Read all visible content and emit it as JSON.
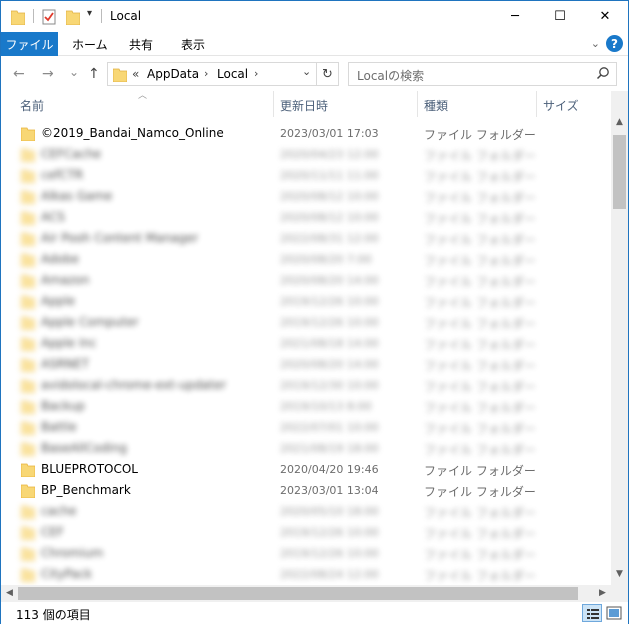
{
  "window": {
    "title": "Local",
    "controls": {
      "minimize": "─",
      "maximize": "☐",
      "close": "✕"
    }
  },
  "ribbon": {
    "tabs": [
      "ファイル",
      "ホーム",
      "共有",
      "表示"
    ],
    "help_label": "?"
  },
  "nav": {
    "back": "←",
    "forward": "→",
    "recent": "⌄",
    "up": "↑",
    "breadcrumb_overflow": "«",
    "breadcrumb": [
      "AppData",
      "Local"
    ],
    "refresh": "↻",
    "search_placeholder": "Localの検索"
  },
  "columns": [
    "名前",
    "更新日時",
    "種類",
    "サイズ"
  ],
  "files": [
    {
      "name": "©2019_Bandai_Namco_Online",
      "date": "2023/03/01 17:03",
      "type": "ファイル フォルダー",
      "blurred": false
    },
    {
      "name": "CEFCache",
      "date": "2020/04/23 12:00",
      "type": "ファイル フォルダー",
      "blurred": true
    },
    {
      "name": "cefCTR",
      "date": "2020/11/11 11:00",
      "type": "ファイル フォルダー",
      "blurred": true
    },
    {
      "name": "Alkas Game",
      "date": "2020/08/12 10:00",
      "type": "ファイル フォルダー",
      "blurred": true
    },
    {
      "name": "ACS",
      "date": "2020/08/12 10:00",
      "type": "ファイル フォルダー",
      "blurred": true
    },
    {
      "name": "Air Pooh Content Manager",
      "date": "2022/08/31 12:00",
      "type": "ファイル フォルダー",
      "blurred": true
    },
    {
      "name": "Adobe",
      "date": "2020/08/20 7:00",
      "type": "ファイル フォルダー",
      "blurred": true
    },
    {
      "name": "Amazon",
      "date": "2020/08/20 14:00",
      "type": "ファイル フォルダー",
      "blurred": true
    },
    {
      "name": "Apple",
      "date": "2019/12/26 10:00",
      "type": "ファイル フォルダー",
      "blurred": true
    },
    {
      "name": "Apple Computer",
      "date": "2019/12/26 10:00",
      "type": "ファイル フォルダー",
      "blurred": true
    },
    {
      "name": "Apple Inc",
      "date": "2021/08/18 14:00",
      "type": "ファイル フォルダー",
      "blurred": true
    },
    {
      "name": "ASRNET",
      "date": "2020/08/20 14:00",
      "type": "ファイル フォルダー",
      "blurred": true
    },
    {
      "name": "avidolocal-chrome-ext-updater",
      "date": "2019/12/30 10:00",
      "type": "ファイル フォルダー",
      "blurred": true
    },
    {
      "name": "Backup",
      "date": "2019/10/13 8:00",
      "type": "ファイル フォルダー",
      "blurred": true
    },
    {
      "name": "Battle",
      "date": "2022/07/01 10:00",
      "type": "ファイル フォルダー",
      "blurred": true
    },
    {
      "name": "BaseAllCoding",
      "date": "2021/08/19 18:00",
      "type": "ファイル フォルダー",
      "blurred": true
    },
    {
      "name": "BLUEPROTOCOL",
      "date": "2020/04/20 19:46",
      "type": "ファイル フォルダー",
      "blurred": false
    },
    {
      "name": "BP_Benchmark",
      "date": "2023/03/01 13:04",
      "type": "ファイル フォルダー",
      "blurred": false
    },
    {
      "name": "cache",
      "date": "2020/05/10 18:00",
      "type": "ファイル フォルダー",
      "blurred": true
    },
    {
      "name": "CEF",
      "date": "2019/12/26 10:00",
      "type": "ファイル フォルダー",
      "blurred": true
    },
    {
      "name": "Chromium",
      "date": "2019/12/26 10:00",
      "type": "ファイル フォルダー",
      "blurred": true
    },
    {
      "name": "CityPack",
      "date": "2022/08/24 12:00",
      "type": "ファイル フォルダー",
      "blurred": true
    }
  ],
  "status": {
    "count_text": "113 個の項目"
  },
  "colors": {
    "accent": "#1979ca",
    "folder": "#f8d775",
    "folder_dark": "#e8b23a"
  }
}
